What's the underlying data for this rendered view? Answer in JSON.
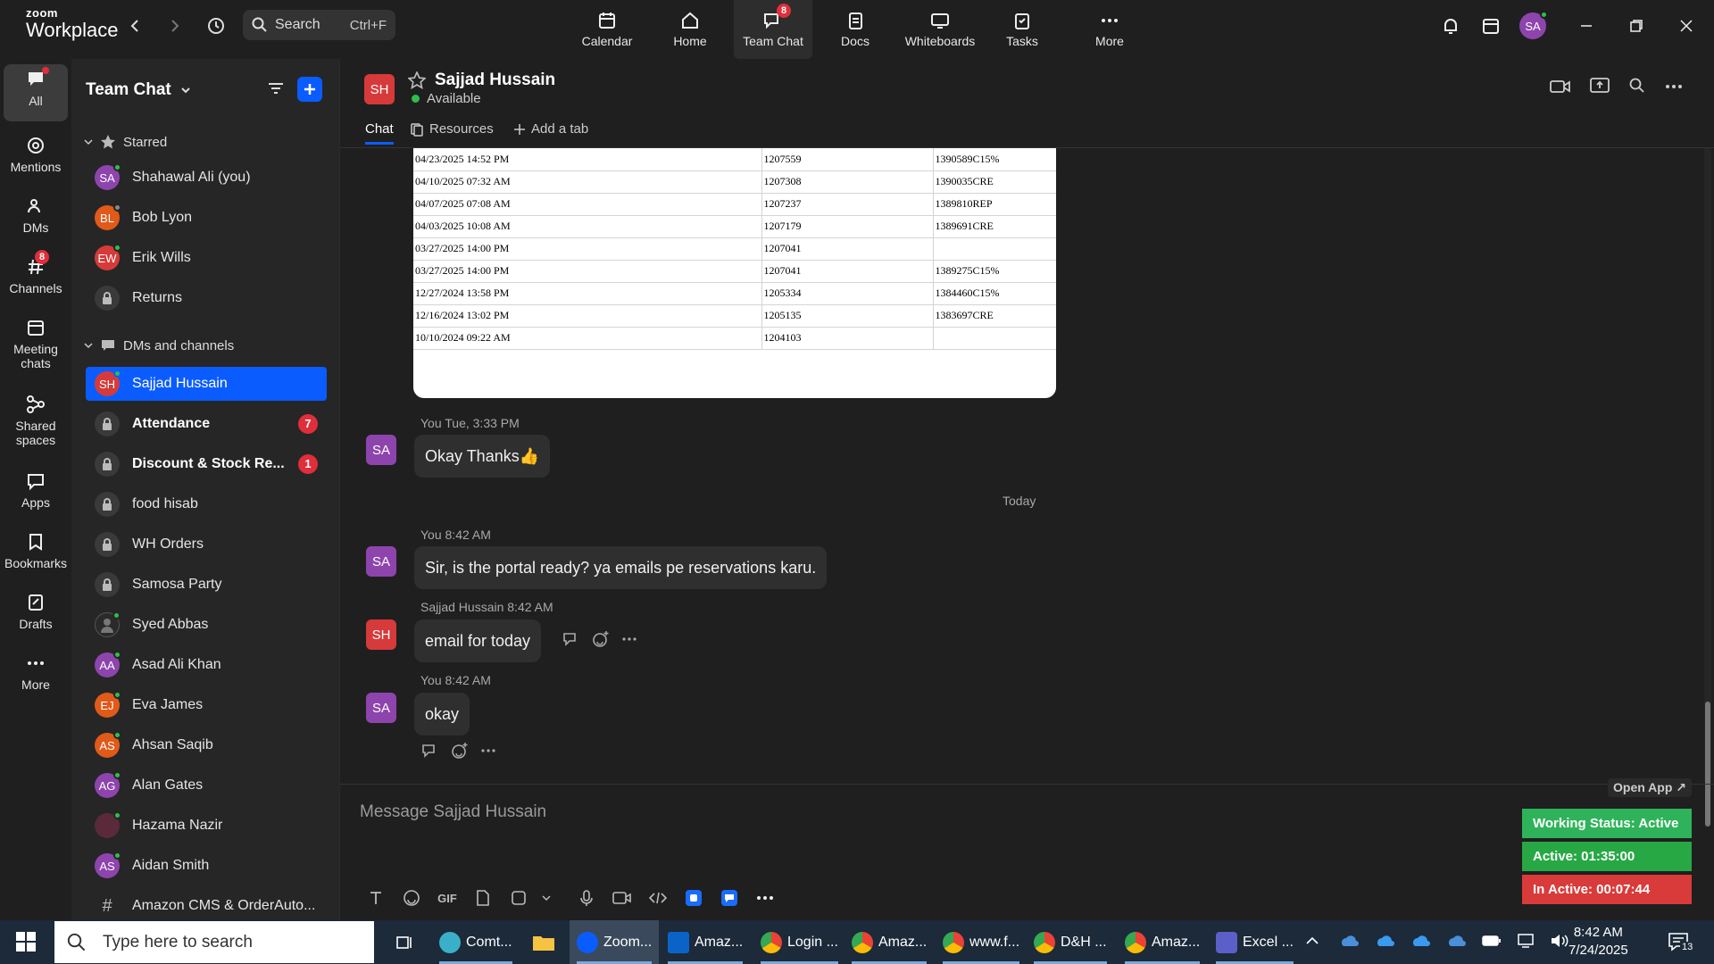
{
  "app": {
    "logo_top": "zoom",
    "logo_bottom": "Workplace"
  },
  "search": {
    "label": "Search",
    "shortcut": "Ctrl+F"
  },
  "top_tabs": [
    {
      "label": "Calendar"
    },
    {
      "label": "Home"
    },
    {
      "label": "Team Chat",
      "badge": "8"
    },
    {
      "label": "Docs"
    },
    {
      "label": "Whiteboards"
    },
    {
      "label": "Tasks"
    },
    {
      "label": "More"
    }
  ],
  "user_avatar": "SA",
  "rail": [
    {
      "label": "All"
    },
    {
      "label": "Mentions"
    },
    {
      "label": "DMs"
    },
    {
      "label": "Channels",
      "badge": "8"
    },
    {
      "label": "Meeting chats"
    },
    {
      "label": "Shared spaces"
    },
    {
      "label": "Apps"
    },
    {
      "label": "Bookmarks"
    },
    {
      "label": "Drafts"
    },
    {
      "label": "More"
    }
  ],
  "sidebar": {
    "title": "Team Chat",
    "starred_label": "Starred",
    "starred": [
      {
        "initials": "SA",
        "name": "Shahawal Ali (you)",
        "color": "#8e44ad"
      },
      {
        "initials": "BL",
        "name": "Bob Lyon",
        "color": "#e05a1a"
      },
      {
        "initials": "EW",
        "name": "Erik Wills",
        "color": "#d63a3a"
      },
      {
        "initials": "",
        "name": "Returns",
        "color": ""
      }
    ],
    "dms_label": "DMs and channels",
    "dms": [
      {
        "initials": "SH",
        "name": "Sajjad Hussain",
        "color": "#d63a3a",
        "selected": true
      },
      {
        "initials": "",
        "name": "Attendance",
        "bold": true,
        "count": "7"
      },
      {
        "initials": "",
        "name": "Discount & Stock Re...",
        "bold": true,
        "count": "1"
      },
      {
        "initials": "",
        "name": "food hisab"
      },
      {
        "initials": "",
        "name": "WH Orders"
      },
      {
        "initials": "",
        "name": "Samosa Party"
      },
      {
        "initials": "",
        "name": "Syed Abbas",
        "color": "#333"
      },
      {
        "initials": "AA",
        "name": "Asad Ali Khan",
        "color": "#8e44ad"
      },
      {
        "initials": "EJ",
        "name": "Eva James",
        "color": "#e05a1a"
      },
      {
        "initials": "AS",
        "name": "Ahsan Saqib",
        "color": "#e05a1a"
      },
      {
        "initials": "AG",
        "name": "Alan Gates",
        "color": "#8e44ad"
      },
      {
        "initials": "",
        "name": "Hazama Nazir",
        "color": "#5a2a3a"
      },
      {
        "initials": "AS",
        "name": "Aidan Smith",
        "color": "#8e44ad"
      },
      {
        "initials": "#",
        "name": "Amazon CMS & OrderAuto...",
        "color": ""
      }
    ]
  },
  "chat": {
    "contact_initials": "SH",
    "contact_name": "Sajjad Hussain",
    "status": "Available",
    "tabs": [
      "Chat",
      "Resources",
      "Add a tab"
    ],
    "table_rows": [
      [
        "04/23/2025 14:52 PM",
        "1207559",
        "1390589C15%"
      ],
      [
        "04/10/2025 07:32 AM",
        "1207308",
        "1390035CRE"
      ],
      [
        "04/07/2025 07:08 AM",
        "1207237",
        "1389810REP"
      ],
      [
        "04/03/2025 10:08 AM",
        "1207179",
        "1389691CRE"
      ],
      [
        "03/27/2025 14:00 PM",
        "1207041",
        ""
      ],
      [
        "03/27/2025 14:00 PM",
        "1207041",
        "1389275C15%"
      ],
      [
        "12/27/2024 13:58 PM",
        "1205334",
        "1384460C15%"
      ],
      [
        "12/16/2024 13:02 PM",
        "1205135",
        "1383697CRE"
      ],
      [
        "10/10/2024 09:22 AM",
        "1204103",
        ""
      ]
    ],
    "messages": [
      {
        "initials": "SA",
        "meta": "You Tue, 3:33 PM",
        "text": "Okay Thanks👍"
      },
      {
        "initials": "SA",
        "meta": "You 8:42 AM",
        "text": "Sir, is the portal ready? ya emails pe reservations karu."
      },
      {
        "initials": "SH",
        "meta": "Sajjad Hussain 8:42 AM",
        "text": "email for today"
      },
      {
        "initials": "SA",
        "meta": "You 8:42 AM",
        "text": "okay"
      }
    ],
    "date_divider": "Today",
    "composer_placeholder": "Message Sajjad Hussain",
    "gif_label": "GIF"
  },
  "working_status": {
    "open_app": "Open App ↗",
    "status": "Working Status: Active",
    "active": "Active: 01:35:00",
    "inactive": "In Active: 00:07:44"
  },
  "taskbar": {
    "search_placeholder": "Type here to search",
    "apps": [
      "Comt...",
      "Zoom...",
      "Amaz...",
      "Login ...",
      "Amaz...",
      "www.f...",
      "D&H ...",
      "Amaz...",
      "Excel ..."
    ],
    "time": "8:42 AM",
    "date": "7/24/2025",
    "notif_count": "13"
  },
  "colors": {
    "accent": "#0b5cff",
    "badge": "#e02e3b",
    "online": "#2fbf4a",
    "active_green": "#27a845",
    "inactive_red": "#d93a3a",
    "status_green": "#2fb35a"
  }
}
